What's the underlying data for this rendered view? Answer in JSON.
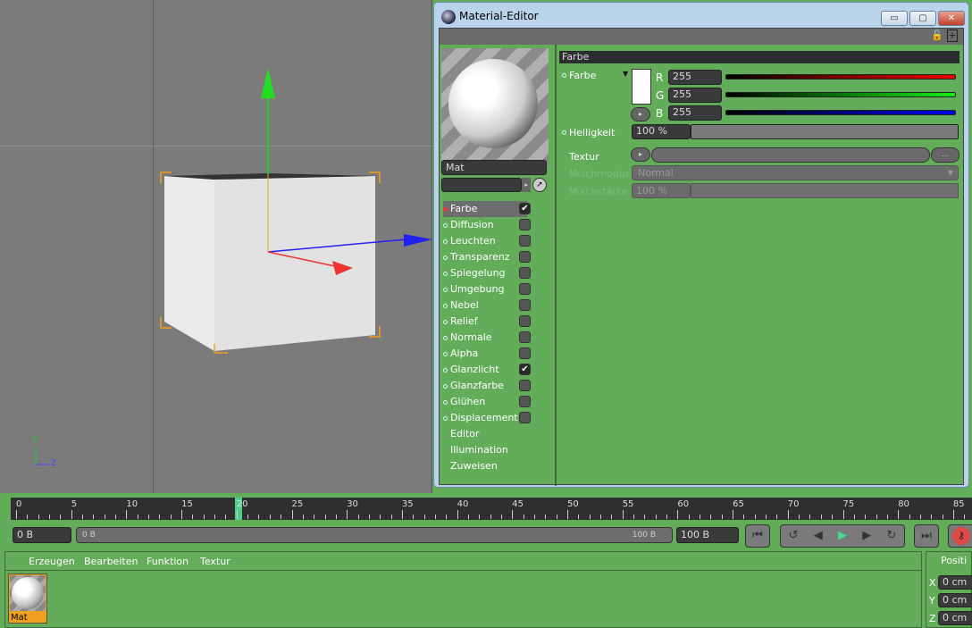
{
  "viewport": {
    "axis_y": "Y",
    "axis_z": "Z"
  },
  "window": {
    "title": "Material-Editor",
    "minimize": "▭",
    "maximize": "▢",
    "close": "✕"
  },
  "material": {
    "name": "Mat",
    "link_field": ""
  },
  "channels": [
    {
      "label": "Farbe",
      "checked": true,
      "active": true
    },
    {
      "label": "Diffusion",
      "checked": false
    },
    {
      "label": "Leuchten",
      "checked": false
    },
    {
      "label": "Transparenz",
      "checked": false
    },
    {
      "label": "Spiegelung",
      "checked": false
    },
    {
      "label": "Umgebung",
      "checked": false
    },
    {
      "label": "Nebel",
      "checked": false
    },
    {
      "label": "Relief",
      "checked": false
    },
    {
      "label": "Normale",
      "checked": false
    },
    {
      "label": "Alpha",
      "checked": false
    },
    {
      "label": "Glanzlicht",
      "checked": true
    },
    {
      "label": "Glanzfarbe",
      "checked": false
    },
    {
      "label": "Glühen",
      "checked": false
    },
    {
      "label": "Displacement",
      "checked": false
    }
  ],
  "extra_items": [
    "Editor",
    "Illumination",
    "Zuweisen"
  ],
  "check_glyph": "✔",
  "farbe": {
    "section": "Farbe",
    "color_label": "Farbe",
    "r_label": "R",
    "g_label": "G",
    "b_label": "B",
    "r": "255",
    "g": "255",
    "b": "255",
    "color": "#ffffff",
    "helligkeit_label": "Helligkeit",
    "helligkeit": "100 %",
    "helligkeit_fraction": 1.0,
    "textur_label": "Textur",
    "textur_more": "...",
    "mischmodus_label": "Mischmodus",
    "mischmodus": "Normal",
    "mischstaerke_label": "Mischstärke",
    "mischstaerke": "100 %"
  },
  "timeline": {
    "ticks": [
      "0",
      "5",
      "10",
      "15",
      "20",
      "25",
      "30",
      "35",
      "40",
      "45",
      "50",
      "55",
      "60",
      "65",
      "70",
      "75",
      "80",
      "85"
    ],
    "current": "20"
  },
  "transport": {
    "start": "0 B",
    "range_start": "0 B",
    "range_end": "100 B",
    "end": "100 B"
  },
  "material_manager": {
    "menu": [
      "Erzeugen",
      "Bearbeiten",
      "Funktion",
      "Textur"
    ],
    "materials": [
      "Mat"
    ]
  },
  "coords": {
    "title": "Positi",
    "x_label": "X",
    "y_label": "Y",
    "z_label": "Z",
    "x": "0 cm",
    "y": "0 cm",
    "z": "0 cm"
  }
}
